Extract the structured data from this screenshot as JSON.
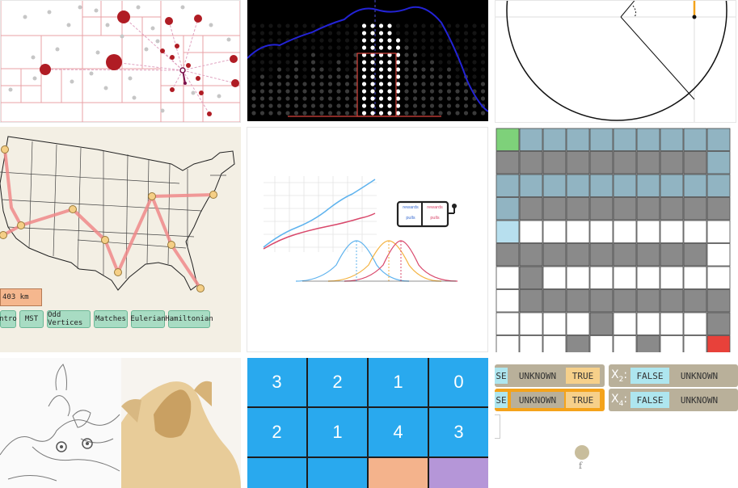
{
  "gallery": {
    "tiles": [
      {
        "name": "quadtree-tile"
      },
      {
        "name": "dot-histogram-tile"
      },
      {
        "name": "circle-angle-tile"
      },
      {
        "name": "tsp-map-tile"
      },
      {
        "name": "bandit-tile"
      },
      {
        "name": "gridworld-tile"
      },
      {
        "name": "cat-edge-tile"
      },
      {
        "name": "number-puzzle-tile"
      },
      {
        "name": "logic-tile"
      }
    ]
  },
  "tsp": {
    "distance": "403 km",
    "buttons": [
      "ntro",
      "MST",
      "Odd Vertices",
      "Matches",
      "Eulerian",
      "Hamiltonian"
    ]
  },
  "bandit": {
    "arm1_top": "rewards",
    "arm1_bottom": "pulls",
    "arm2_top": "rewards",
    "arm2_bottom": "pulls"
  },
  "puzzle": {
    "row1": [
      "3",
      "2",
      "1",
      "0"
    ],
    "row2": [
      "2",
      "1",
      "4",
      "3"
    ]
  },
  "logic": {
    "row1": [
      "SE",
      "UNKNOWN",
      "TRUE",
      "FALSE",
      "UNKNOWN"
    ],
    "row2": [
      "SE",
      "UNKNOWN",
      "TRUE",
      "FALSE",
      "UNKNOWN"
    ],
    "var1": "X",
    "var1_sub": "2",
    "var2": "X",
    "var2_sub": "4",
    "node_label": "f"
  },
  "colors": {
    "quadtree_red": "#b01c24",
    "histogram_blue": "#2323d6",
    "map_bg": "#f3efe4",
    "route_red": "#f07a7a",
    "button_green": "#a8dcc3",
    "grid_slate": "#91b4c2",
    "grid_gray": "#8a8a8a",
    "grid_green": "#7ed17a",
    "grid_red": "#e8413a",
    "puzzle_blue": "#29a9ee",
    "logic_orange": "#f4a31b"
  }
}
